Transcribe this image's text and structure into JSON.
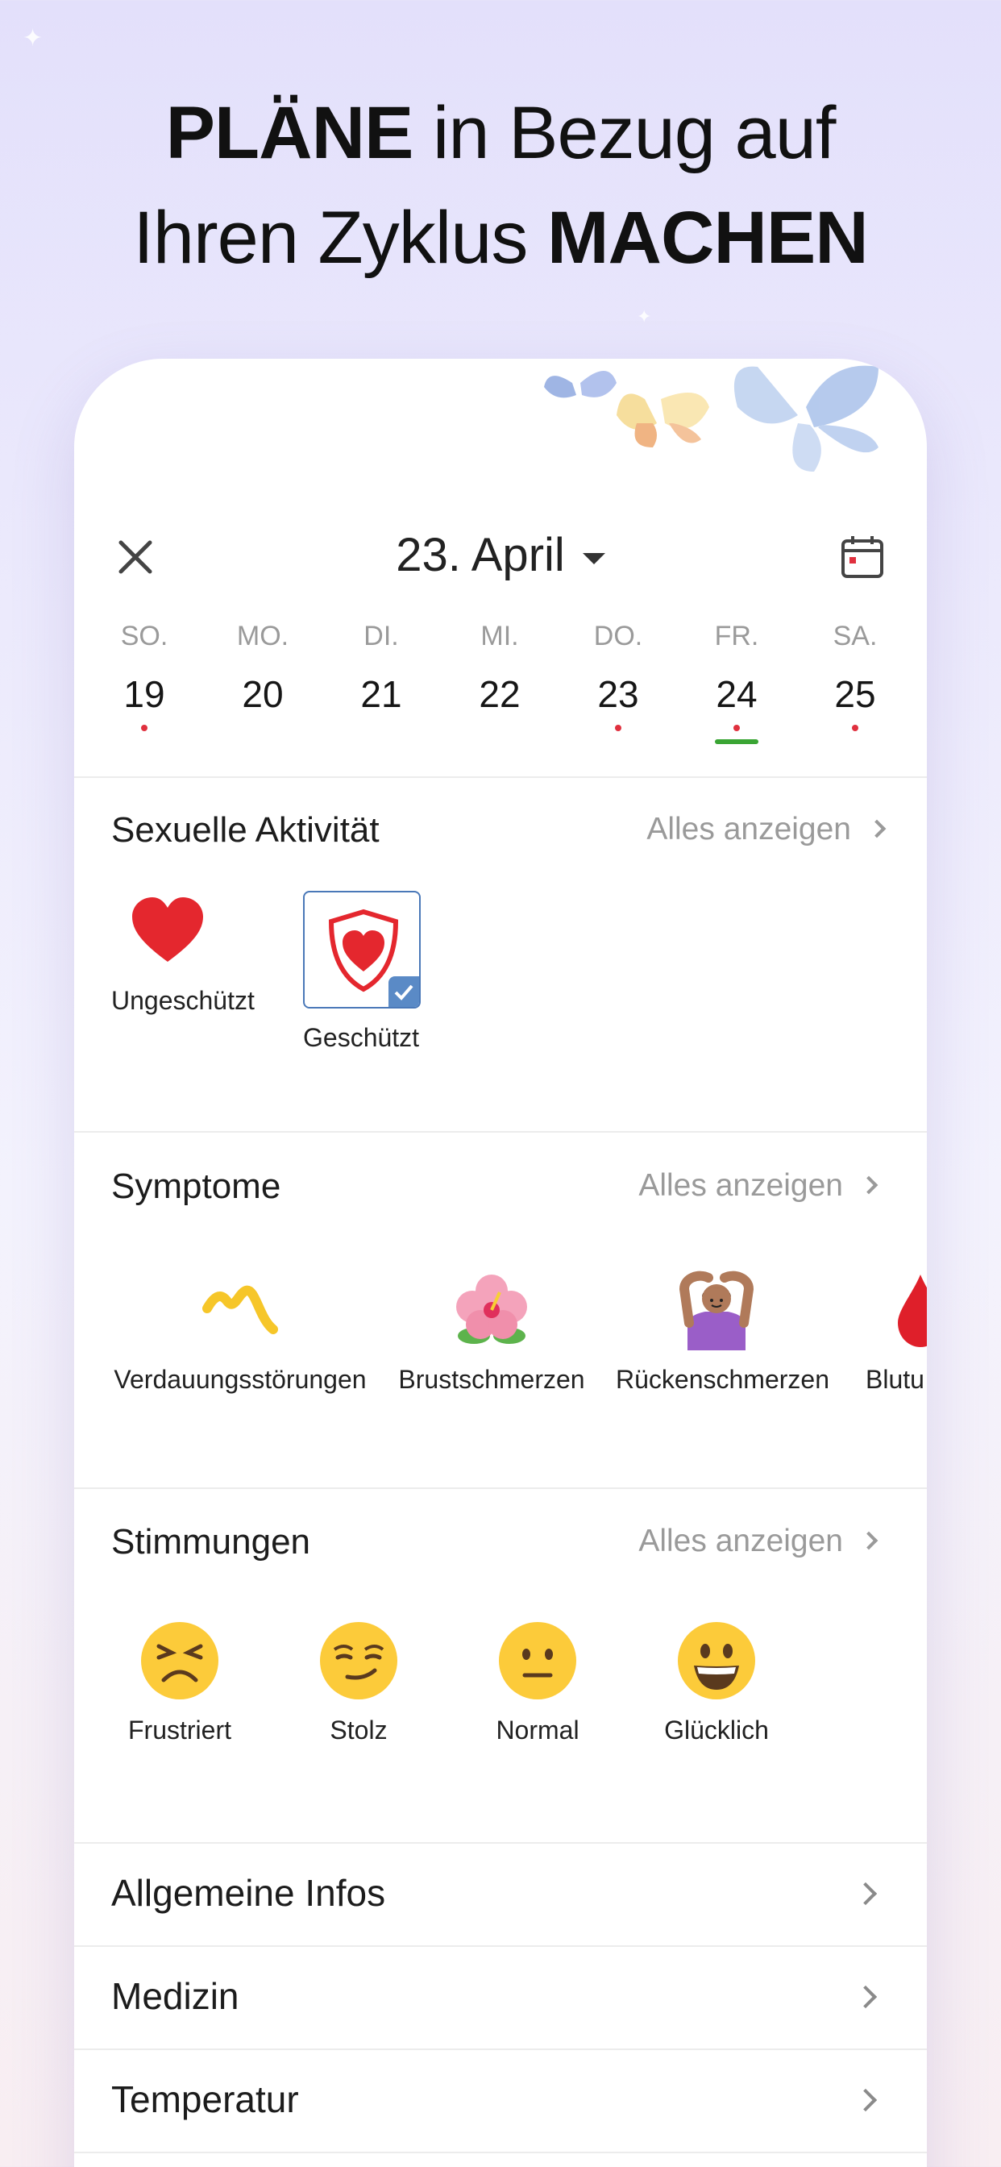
{
  "headline": {
    "bold1": "PLÄNE",
    "rest1": " in Bezug auf",
    "rest2": "Ihren Zyklus ",
    "bold2": "MACHEN"
  },
  "header": {
    "date": "23. April"
  },
  "week": [
    {
      "name": "SO.",
      "num": "19",
      "dot": true
    },
    {
      "name": "MO.",
      "num": "20",
      "dot": false
    },
    {
      "name": "DI.",
      "num": "21",
      "dot": false
    },
    {
      "name": "MI.",
      "num": "22",
      "dot": false
    },
    {
      "name": "DO.",
      "num": "23",
      "dot": true,
      "selected": true
    },
    {
      "name": "FR.",
      "num": "24",
      "dot": true,
      "underline": true
    },
    {
      "name": "SA.",
      "num": "25",
      "dot": true
    }
  ],
  "sexual": {
    "title": "Sexuelle Aktivität",
    "see_all": "Alles anzeigen",
    "items": [
      {
        "label": "Ungeschützt",
        "icon": "heart-icon"
      },
      {
        "label": "Geschützt",
        "icon": "shield-heart-icon",
        "selected": true
      }
    ]
  },
  "symptoms": {
    "title": "Symptome",
    "see_all": "Alles anzeigen",
    "items": [
      {
        "label": "Verdauungsstörungen",
        "icon": "squiggle-icon"
      },
      {
        "label": "Brustschmerzen",
        "icon": "hibiscus-icon"
      },
      {
        "label": "Rückenschmerzen",
        "icon": "woman-gesture-icon"
      },
      {
        "label": "Blutu",
        "icon": "blood-drop-icon"
      }
    ]
  },
  "moods": {
    "title": "Stimmungen",
    "see_all": "Alles anzeigen",
    "items": [
      {
        "label": "Frustriert",
        "icon": "frustrated-face-icon"
      },
      {
        "label": "Stolz",
        "icon": "smirk-face-icon"
      },
      {
        "label": "Normal",
        "icon": "neutral-face-icon"
      },
      {
        "label": "Glücklich",
        "icon": "happy-face-icon"
      }
    ]
  },
  "rows": [
    {
      "label": "Allgemeine Infos"
    },
    {
      "label": "Medizin"
    },
    {
      "label": "Temperatur"
    }
  ],
  "colors": {
    "accent_red": "#e0303e",
    "selected_day_bg": "#fbd9dd",
    "period_underline": "#3aa534",
    "check_blue": "#5a8ac6"
  }
}
